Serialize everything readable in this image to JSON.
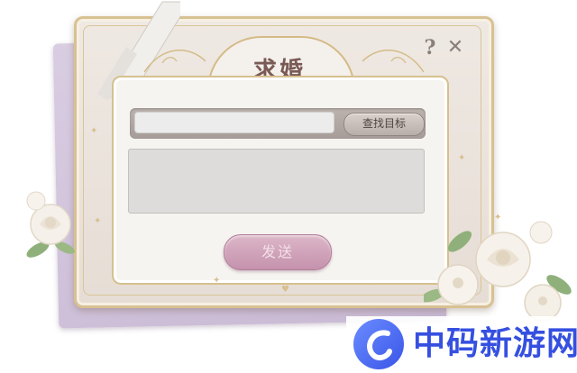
{
  "dialog": {
    "title": "求婚",
    "search": {
      "value": "",
      "placeholder": ""
    },
    "find_button_label": "查找目标",
    "message": {
      "value": ""
    },
    "send_button_label": "发送",
    "help_icon": "?",
    "close_icon": "✕"
  },
  "watermark": {
    "text": "中码新游网",
    "logo": "c-swirl-logo"
  },
  "colors": {
    "frame_gold": "#d8c192",
    "title_text": "#7a5a54",
    "send_button": "#c592ad",
    "back_card": "#c9b9d4",
    "watermark_blue": "#3550e0"
  }
}
